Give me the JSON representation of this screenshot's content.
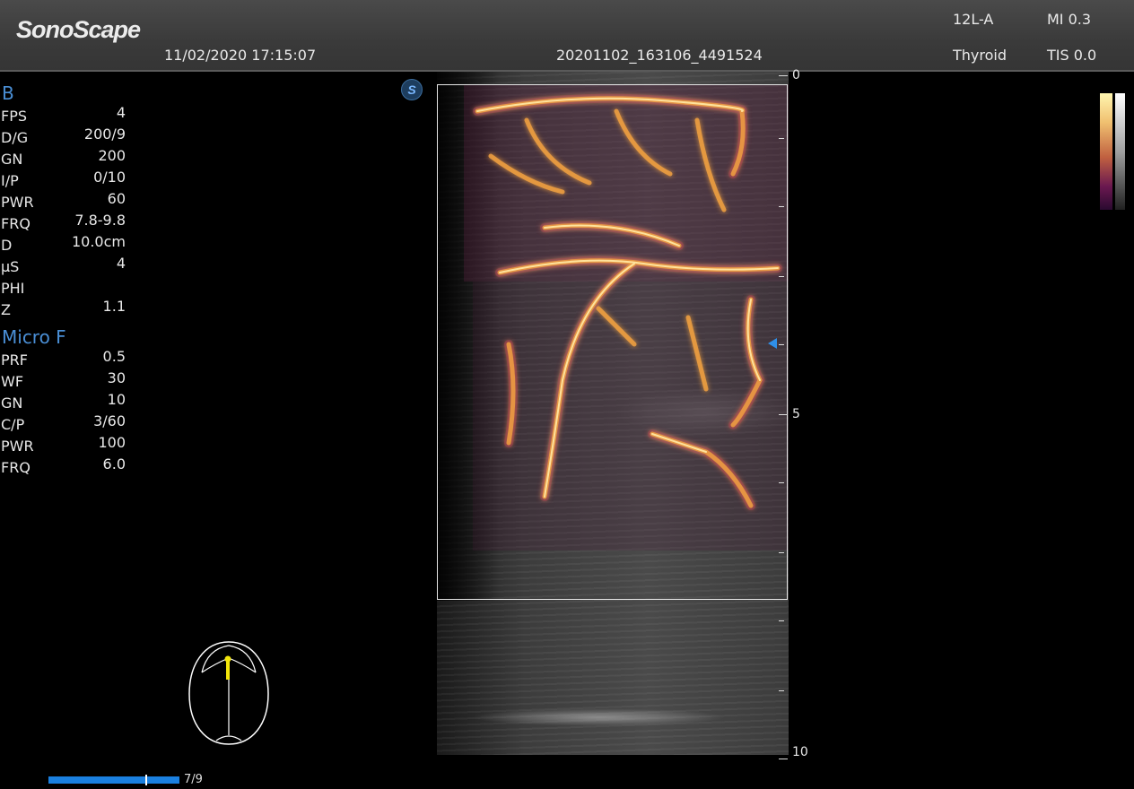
{
  "header": {
    "logo": "SonoScape",
    "datetime": "11/02/2020 17:15:07",
    "patient_id": "20201102_163106_4491524",
    "probe": "12L-A",
    "preset": "Thyroid",
    "mi": "MI 0.3",
    "tis": "TIS 0.0"
  },
  "b_mode": {
    "title": "B",
    "params": [
      {
        "key": "FPS",
        "value": "4"
      },
      {
        "key": "D/G",
        "value": "200/9"
      },
      {
        "key": "GN",
        "value": "200"
      },
      {
        "key": "I/P",
        "value": "0/10"
      },
      {
        "key": "PWR",
        "value": "60"
      },
      {
        "key": "FRQ",
        "value": "7.8-9.8"
      },
      {
        "key": "D",
        "value": "10.0cm"
      },
      {
        "key": "μS",
        "value": "4"
      },
      {
        "key": "PHI",
        "value": ""
      },
      {
        "key": "Z",
        "value": "1.1"
      }
    ]
  },
  "micro_f": {
    "title": "Micro F",
    "params": [
      {
        "key": "PRF",
        "value": "0.5"
      },
      {
        "key": "WF",
        "value": "30"
      },
      {
        "key": "GN",
        "value": "10"
      },
      {
        "key": "C/P",
        "value": "3/60"
      },
      {
        "key": "PWR",
        "value": "100"
      },
      {
        "key": "FRQ",
        "value": "6.0"
      }
    ]
  },
  "depth_scale": {
    "labels": [
      "0",
      "5",
      "10"
    ]
  },
  "logo_badge": "S",
  "cine": {
    "label": "7/9",
    "current": 7,
    "total": 9
  },
  "colors": {
    "accent": "#4a8fd6",
    "focus_marker": "#2f8fe8",
    "flow_bright": "#ffe6a0",
    "flow_mid": "#f0a040",
    "flow_dark": "#8a2050"
  },
  "icons": {
    "brand_badge": "sonoscape-s-icon",
    "body_marker": "head-body-marker-icon",
    "focus": "focus-triangle-icon"
  }
}
